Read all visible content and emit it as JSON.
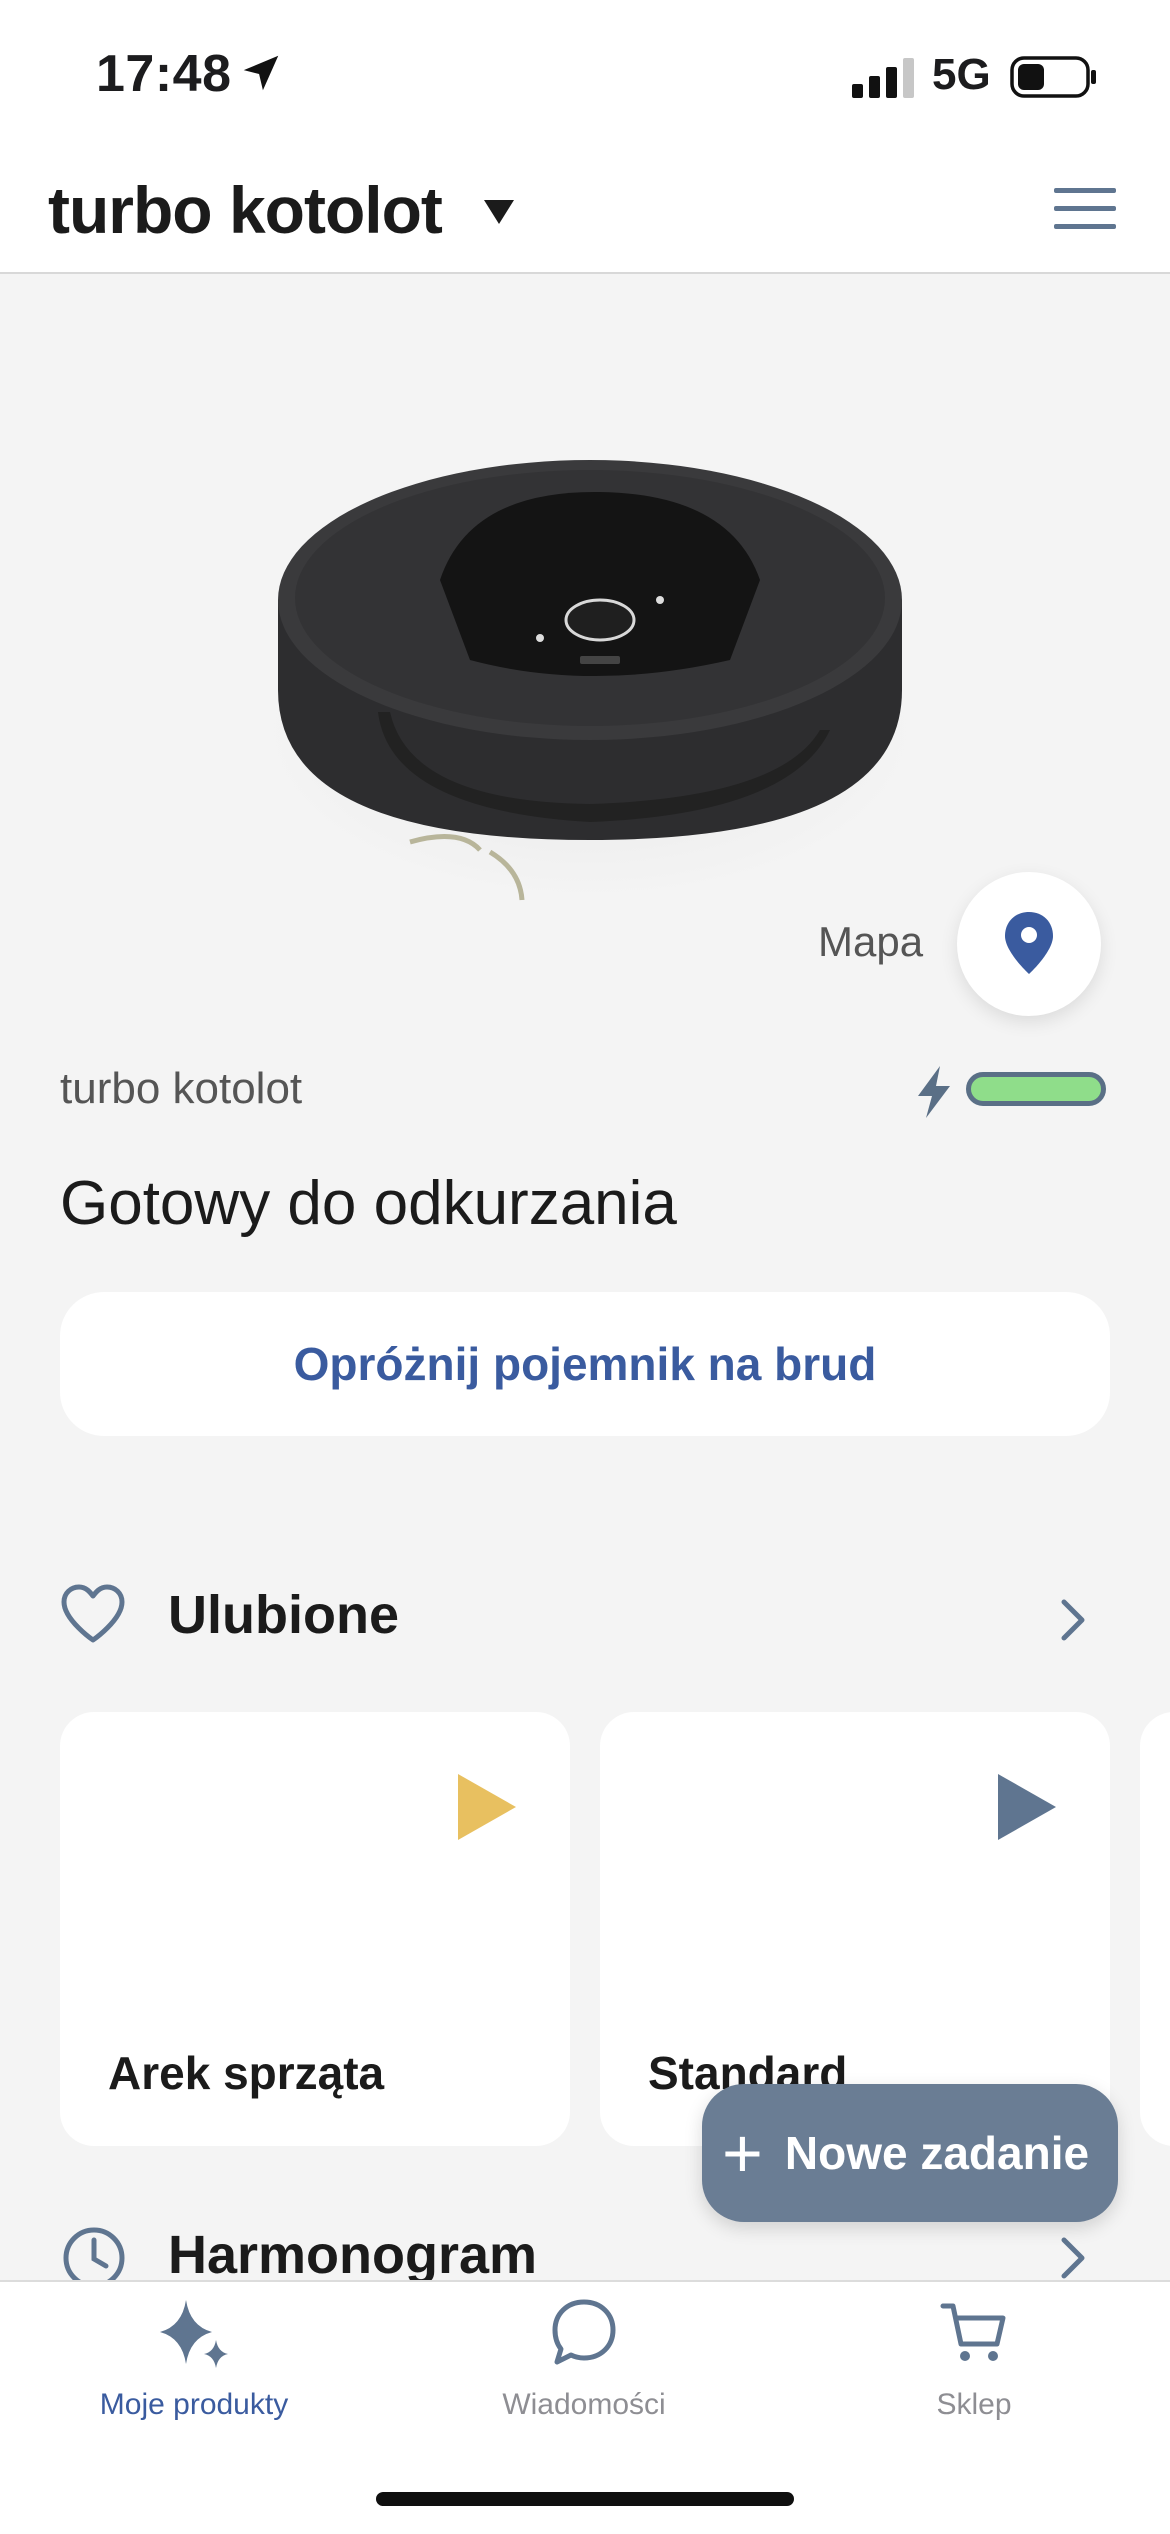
{
  "status_bar": {
    "time": "17:48",
    "network": "5G"
  },
  "header": {
    "robot_name": "turbo kotolot"
  },
  "map": {
    "label": "Mapa"
  },
  "robot": {
    "name": "turbo kotolot",
    "status": "Gotowy do odkurzania"
  },
  "actions": {
    "empty_bin": "Opróżnij pojemnik na brud"
  },
  "favorites": {
    "title": "Ulubione",
    "items": [
      {
        "label": "Arek sprząta",
        "play_color": "#e8c060"
      },
      {
        "label": "Standard",
        "play_color": "#5f7590"
      }
    ]
  },
  "fab": {
    "label": "Nowe zadanie"
  },
  "schedule": {
    "title": "Harmonogram"
  },
  "tabbar": {
    "items": [
      {
        "label": "Moje produkty",
        "icon": "sparkle-icon",
        "active": true
      },
      {
        "label": "Wiadomości",
        "icon": "chat-bubble-icon",
        "active": false
      },
      {
        "label": "Sklep",
        "icon": "cart-icon",
        "active": false
      }
    ]
  },
  "colors": {
    "accent": "#3a5b9f",
    "fab": "#6a7d94",
    "battery": "#8fdd8a",
    "inactive": "#8e8e93"
  }
}
